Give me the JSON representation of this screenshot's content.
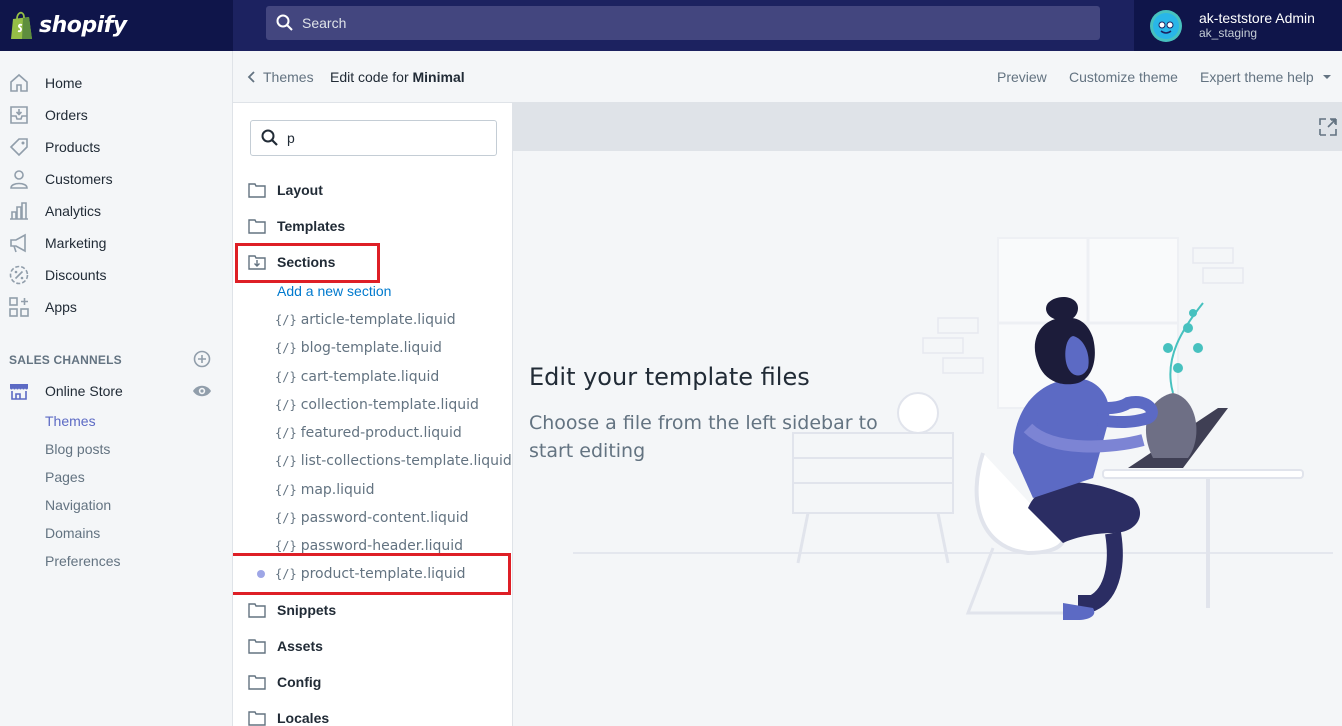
{
  "topbar": {
    "brand": "shopify",
    "search_placeholder": "Search",
    "account_name": "ak-teststore Admin",
    "account_sub": "ak_staging"
  },
  "nav": {
    "items": [
      {
        "label": "Home",
        "icon": "home-icon"
      },
      {
        "label": "Orders",
        "icon": "orders-icon"
      },
      {
        "label": "Products",
        "icon": "tag-icon"
      },
      {
        "label": "Customers",
        "icon": "person-icon"
      },
      {
        "label": "Analytics",
        "icon": "bar-chart-icon"
      },
      {
        "label": "Marketing",
        "icon": "megaphone-icon"
      },
      {
        "label": "Discounts",
        "icon": "discount-icon"
      },
      {
        "label": "Apps",
        "icon": "apps-icon"
      }
    ],
    "channels_header": "SALES CHANNELS",
    "online_store": "Online Store",
    "sub_items": [
      "Themes",
      "Blog posts",
      "Pages",
      "Navigation",
      "Domains",
      "Preferences"
    ],
    "active_sub": "Themes"
  },
  "header": {
    "back_label": "Themes",
    "crumb_prefix": "Edit code for ",
    "crumb_theme": "Minimal",
    "preview": "Preview",
    "customize": "Customize theme",
    "expert_help": "Expert theme help"
  },
  "files": {
    "search_value": "p",
    "folders": [
      "Layout",
      "Templates",
      "Sections",
      "Snippets",
      "Assets",
      "Config",
      "Locales"
    ],
    "add_section": "Add a new section",
    "file_prefix": "{/}",
    "section_files": [
      "article-template.liquid",
      "blog-template.liquid",
      "cart-template.liquid",
      "collection-template.liquid",
      "featured-product.liquid",
      "list-collections-template.liquid",
      "map.liquid",
      "password-content.liquid",
      "password-header.liquid",
      "product-template.liquid"
    ]
  },
  "editor": {
    "title": "Edit your template files",
    "subtitle": "Choose a file from the left sidebar to start editing"
  },
  "colors": {
    "topbar": "#1c2260",
    "accent": "#5c6ac4",
    "link": "#007ace",
    "highlight_box": "#de1f26"
  }
}
